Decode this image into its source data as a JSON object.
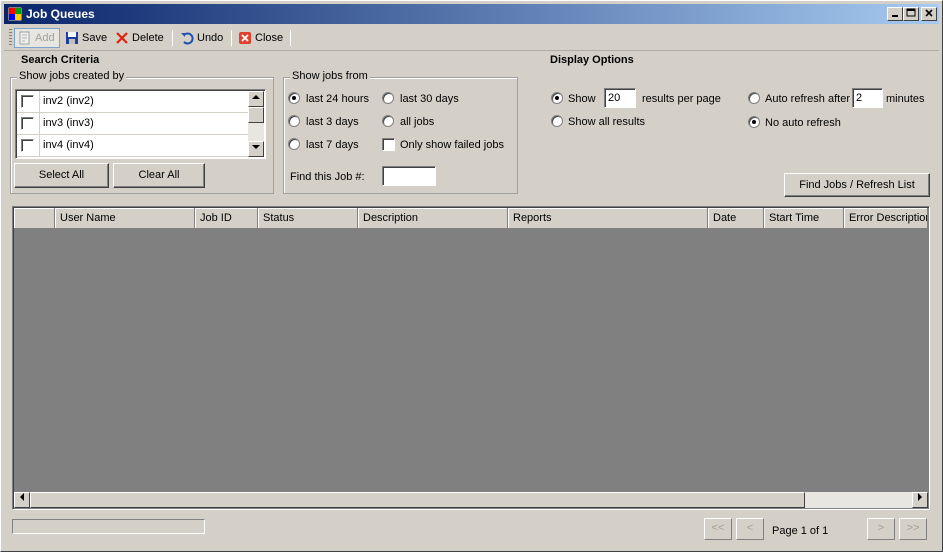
{
  "window": {
    "title": "Job Queues"
  },
  "toolbar": {
    "add_label": "Add",
    "save_label": "Save",
    "delete_label": "Delete",
    "undo_label": "Undo",
    "close_label": "Close"
  },
  "search": {
    "title": "Search Criteria",
    "created_by_label": "Show jobs created by",
    "users": [
      {
        "label": "inv2 (inv2)",
        "checked": false
      },
      {
        "label": "inv3 (inv3)",
        "checked": false
      },
      {
        "label": "inv4 (inv4)",
        "checked": false
      }
    ],
    "select_all_label": "Select All",
    "clear_all_label": "Clear All",
    "jobs_from_label": "Show jobs from",
    "range_options": {
      "last_24_hours": "last 24 hours",
      "last_3_days": "last 3 days",
      "last_7_days": "last 7 days",
      "last_30_days": "last 30 days",
      "all_jobs": "all jobs"
    },
    "selected_range": "last 24 hours",
    "only_failed_label": "Only show failed jobs",
    "find_job_label": "Find this Job #:",
    "find_job_value": ""
  },
  "display": {
    "title": "Display Options",
    "show_label": "Show",
    "results_count": "20",
    "results_per_page_label": "results per page",
    "show_all_label": "Show all results",
    "auto_refresh_label": "Auto refresh after",
    "auto_refresh_minutes": "2",
    "minutes_label": "minutes",
    "no_auto_refresh_label": "No auto refresh",
    "find_button_label": "Find Jobs / Refresh List"
  },
  "grid": {
    "columns": [
      "User Name",
      "Job ID",
      "Status",
      "Description",
      "Reports",
      "Date",
      "Start Time",
      "Error Description"
    ],
    "rows": []
  },
  "pager": {
    "first_label": "<<",
    "prev_label": "<",
    "page_text": "Page 1 of 1",
    "next_label": ">",
    "last_label": ">>"
  },
  "colors": {
    "titlebar_start": "#0a246a",
    "titlebar_end": "#a6caf0",
    "face": "#d4d0c8",
    "grid_background": "#808080"
  }
}
